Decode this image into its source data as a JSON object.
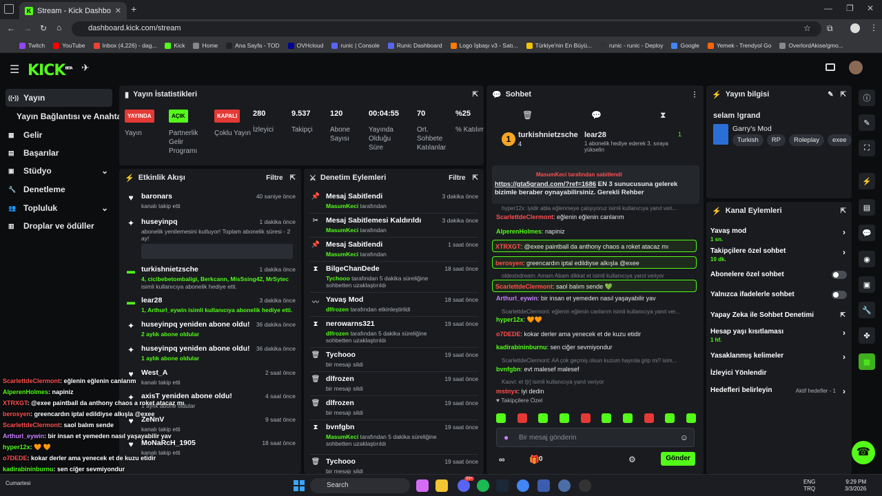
{
  "browser": {
    "tab_title": "Stream - Kick Dashboard",
    "url": "dashboard.kick.com/stream",
    "bookmarks": [
      "Twitch",
      "YouTube",
      "Inbox (4,226) - dag...",
      "Kick",
      "Home",
      "Ana Sayfa - TOD",
      "OVHcloud",
      "runic | Console",
      "Runic Dashboard",
      "Logo İşbaşı v3 - Satı...",
      "Türkiye'nin En Büyü...",
      "runic - runic - Deploy",
      "Google",
      "Yemek - Trendyol Go",
      "OverlordAkise/gmo..."
    ]
  },
  "logo": "KICK",
  "logo_sup": "BETA",
  "sidebar": {
    "items": [
      {
        "label": "Yayın",
        "icon": "broadcast-icon"
      },
      {
        "label": "Yayın Bağlantısı ve Anahtarı"
      },
      {
        "label": "Gelir",
        "icon": "revenue-icon"
      },
      {
        "label": "Başarılar",
        "icon": "achievement-icon"
      },
      {
        "label": "Stüdyo",
        "icon": "studio-icon"
      },
      {
        "label": "Denetleme",
        "icon": "wrench-icon"
      },
      {
        "label": "Topluluk",
        "icon": "community-icon"
      },
      {
        "label": "Droplar ve ödüller",
        "icon": "drops-icon"
      }
    ]
  },
  "stats": {
    "title": "Yayın İstatistikleri",
    "items": [
      {
        "badge": "YAYINDA",
        "label": "Yayın",
        "color": "#e53935"
      },
      {
        "badge": "AÇIK",
        "label": "Partnerlik Gelir Programı",
        "color": "#53fc18"
      },
      {
        "badge": "KAPALI",
        "label": "Çoklu Yayın",
        "color": "#e53935"
      },
      {
        "value": "280",
        "label": "İzleyici"
      },
      {
        "value": "9.537",
        "label": "Takipçi"
      },
      {
        "value": "120",
        "label": "Abone Sayısı"
      },
      {
        "value": "00:04:55",
        "label": "Yayında Olduğu Süre"
      },
      {
        "value": "70",
        "label": "Ort. Sohbete Katılanlar"
      },
      {
        "value": "%25",
        "label": "% Katılım"
      }
    ]
  },
  "activity": {
    "title": "Etkinlik Akışı",
    "filter": "Filtre",
    "rows": [
      {
        "title": "baronars",
        "sub": "kanalı takip etti",
        "time": "40 saniye önce"
      },
      {
        "title": "huseyinpq",
        "sub": "abonelik yenilemesini kutluyor! Toplam abonelik süresi - 2 ay!",
        "time": "1 dakika önce"
      },
      {
        "title": "turkishnietzsche",
        "sub": "4, cicibebetombaligi, Berkcann, MisSsing42, MrSytec",
        "sub2": "isimli kullanıcıya abonelik hediye etti.",
        "time": "1 dakika önce"
      },
      {
        "title": "lear28",
        "sub": "1, Arthurl_eywin isimli kullanıcıya abonelik hediye etti.",
        "time": "3 dakika önce"
      },
      {
        "title": "huseyinpq yeniden abone oldu!",
        "sub": "2 aylık abone oldular",
        "time": "36 dakika önce"
      },
      {
        "title": "huseyinpq yeniden abone oldu!",
        "sub": "1 aylık abone oldular",
        "time": "36 dakika önce"
      },
      {
        "title": "West_A",
        "sub": "kanalı takip etti",
        "time": "2 saat önce"
      },
      {
        "title": "axisT yeniden abone oldu!",
        "sub": "1 aylık abone oldular",
        "time": "4 saat önce"
      },
      {
        "title": "ZeNnV",
        "sub": "kanalı takip etti",
        "time": "9 saat önce"
      },
      {
        "title": "MoNaRcH_1905",
        "sub": "kanalı takip etti",
        "time": "18 saat önce"
      }
    ]
  },
  "moderation": {
    "title": "Denetim Eylemleri",
    "filter": "Filtre",
    "rows": [
      {
        "title": "Mesaj Sabitlendi",
        "mod": "MasumKeci",
        "sub": "tarafından",
        "time": "3 dakika önce"
      },
      {
        "title": "Mesaj Sabitlemesi Kaldırıldı",
        "mod": "MasumKeci",
        "sub": "tarafından",
        "time": "3 dakika önce"
      },
      {
        "title": "Mesaj Sabitlendi",
        "mod": "MasumKeci",
        "sub": "tarafından",
        "time": "1 saat önce"
      },
      {
        "title": "BilgeChanDede",
        "mod": "Tychooo",
        "sub": "tarafından 5 dakika süreliğine sohbetten uzaklaştırıldı",
        "time": "18 saat önce"
      },
      {
        "title": "Yavaş Mod",
        "mod": "dlfrozen",
        "sub": "tarafından etkinleştirildi",
        "time": "18 saat önce"
      },
      {
        "title": "nerowarns321",
        "mod": "dlfrozen",
        "sub": "tarafından 5 dakika süreliğine sohbetten uzaklaştırıldı",
        "time": "19 saat önce"
      },
      {
        "title": "Tychooo",
        "mod": "",
        "sub": "bir mesajı sildi",
        "time": "19 saat önce"
      },
      {
        "title": "dlfrozen",
        "mod": "",
        "sub": "bir mesajı sildi",
        "time": "19 saat önce"
      },
      {
        "title": "dlfrozen",
        "mod": "",
        "sub": "bir mesajı sildi",
        "time": "19 saat önce"
      },
      {
        "title": "bvnfgbn",
        "mod": "MasumKeci",
        "sub": "tarafından 5 dakika süreliğine sohbetten uzaklaştırıldı",
        "time": "19 saat önce"
      },
      {
        "title": "Tychooo",
        "mod": "",
        "sub": "bir mesajı sildi",
        "time": "19 saat önce"
      }
    ]
  },
  "chat": {
    "title": "Sohbet",
    "top1": "turkishnietzsche",
    "top1_count": "4",
    "top2": "lear28",
    "top2_count": "1",
    "top2_sub": "1 abonelik hediye ederek 3. sıraya yükselin",
    "pinned_by": "MasumKeci tarafından sabitlendi",
    "pinned_link": "https://gta5grand.com/?ref=1686",
    "pinned_text": "EN 3 sunucusuna gelerek bizimle beraber oynayabilirsiniz. Gerekli Rehber Discordta...",
    "lines": [
      {
        "reply": "hyper12x: iyidir abla eğlenmeye çalışıyoruz isimli kullanıcıya yanıt veri..."
      },
      {
        "user": "ScarlettdeClermont",
        "color": "#ff4f4f",
        "text": "eğlenin eğlenin canlarım"
      },
      {
        "user": "AlperenHolmes",
        "color": "#53fc18",
        "text": "napiniz"
      },
      {
        "user": "XTRXGT",
        "color": "#ff4f4f",
        "text": "@exee paintball da anthony chaos a roket atacaz mı",
        "hl": true
      },
      {
        "user": "berosyen",
        "color": "#ff4f4f",
        "text": "greencardın iptal edildiyse alkışla @exee",
        "hl": true
      },
      {
        "reply": "oldestxdream: Amam Abam dikkat et isimli kullanıcıya yanıt veriyor"
      },
      {
        "user": "ScarlettdeClermont",
        "color": "#ff4f4f",
        "text": "saol balım sende 💚",
        "hl": true
      },
      {
        "user": "Arthurl_eywin",
        "color": "#c980ff",
        "text": "bir insan et yemeden nasıl yaşayabilir yav"
      },
      {
        "reply": "ScarlettdeClermont: eğlenin eğlenin canlarım isimli kullanıcıya yanıt ver..."
      },
      {
        "user": "hyper12x",
        "color": "#53fc18",
        "text": "🧡🧡"
      },
      {
        "user": "o7DEDE",
        "color": "#ff4f4f",
        "text": "kokar derler ama yenecek et de kuzu etidir"
      },
      {
        "user": "kadirabininburnu",
        "color": "#53fc18",
        "text": "sen ciğer sevmiyondur"
      },
      {
        "reply": "ScarlettdeClermont: AA çok geçmiş olsun kuzum hayrola grip mi? isim..."
      },
      {
        "user": "bvnfgbn",
        "color": "#53fc18",
        "text": "evt malesef malesef"
      },
      {
        "reply": "Kaovi: et t]r] isimli kullanıcıya yanıt veriyor"
      },
      {
        "user": "mstnyx",
        "color": "#ff4f4f",
        "text": "iyi dedin"
      }
    ],
    "emote_label": "Takipçilere Özel",
    "input_placeholder": "Bir mesaj gönderin",
    "points": "0",
    "send": "Gönder"
  },
  "stream_info": {
    "title": "Yayın bilgisi",
    "stream_title": "selam !grand",
    "game": "Garry's Mod",
    "tags": [
      "Turkish",
      "RP",
      "Roleplay",
      "exee"
    ]
  },
  "channel_actions": {
    "title": "Kanal Eylemleri",
    "items": [
      {
        "label": "Yavaş mod",
        "sub": "1 sn.",
        "kind": "chev"
      },
      {
        "label": "Takipçilere özel sohbet",
        "sub": "10 dk.",
        "kind": "chev"
      },
      {
        "label": "Abonelere özel sohbet",
        "kind": "toggle"
      },
      {
        "label": "Yalnızca ifadelerle sohbet",
        "kind": "toggle"
      },
      {
        "label": "Yapay Zeka ile Sohbet Denetimi",
        "kind": "ext"
      },
      {
        "label": "Hesap yaşı kısıtlaması",
        "sub": "1 hf.",
        "kind": "chev"
      },
      {
        "label": "Yasaklanmış kelimeler",
        "kind": "chev"
      },
      {
        "label": "İzleyici Yönlendir",
        "kind": "none"
      },
      {
        "label": "Hedefleri belirleyin",
        "badge": "Aktif hedefler - 1",
        "kind": "chev"
      }
    ]
  },
  "overlay": [
    {
      "user": "ScarlettdeClermont",
      "color": "#ff4f4f",
      "text": "eğlenin eğlenin canlarım"
    },
    {
      "user": "AlperenHolmes",
      "color": "#53fc18",
      "text": "napiniz"
    },
    {
      "user": "XTRXGT",
      "color": "#ff4f4f",
      "text": "@exee paintball da anthony chaos a roket atacaz mı"
    },
    {
      "user": "berosyen",
      "color": "#ff4f4f",
      "text": "greencardın iptal edildiyse alkışla @exee"
    },
    {
      "user": "ScarlettdeClermont",
      "color": "#ff4f4f",
      "text": "saol balım sende"
    },
    {
      "user": "Arthurl_eywin",
      "color": "#c980ff",
      "text": "bir insan et yemeden nasıl yaşayabilir yav"
    },
    {
      "user": "hyper12x",
      "color": "#53fc18",
      "text": "🧡 🧡"
    },
    {
      "user": "o7DEDE",
      "color": "#ff4f4f",
      "text": "kokar derler ama yenecek et de kuzu etidir"
    },
    {
      "user": "kadirabininburnu",
      "color": "#53fc18",
      "text": "sen ciğer sevmiyondur"
    },
    {
      "user": "bvnfgbn",
      "color": "#53fc18",
      "text": "evt malesef malesef"
    }
  ],
  "taskbar": {
    "weather": "Cumartesi",
    "search": "Search",
    "lang1": "ENG",
    "lang2": "TRQ",
    "time": "9:29 PM",
    "date": "3/3/2026",
    "badge": "99+"
  }
}
